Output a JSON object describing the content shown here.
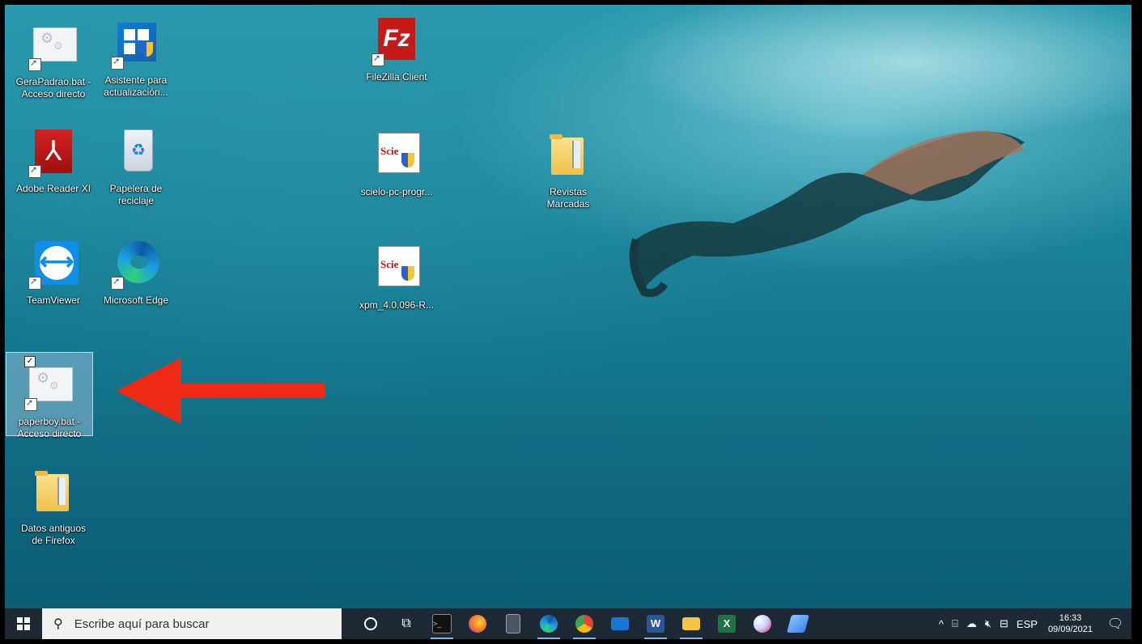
{
  "desktop": {
    "icons": [
      {
        "label": "GeraPadrao.bat -\nAcceso directo",
        "icon": "batch-file-shortcut-icon"
      },
      {
        "label": "Asistente para\nactualización...",
        "icon": "windows-update-assistant-icon"
      },
      {
        "label": "FileZilla Client",
        "icon": "filezilla-icon"
      },
      {
        "label": "Adobe Reader XI",
        "icon": "adobe-reader-icon"
      },
      {
        "label": "Papelera de\nreciclaje",
        "icon": "recycle-bin-icon"
      },
      {
        "label": "scielo-pc-progr...",
        "icon": "scielo-installer-icon"
      },
      {
        "label": "Revistas\nMarcadas",
        "icon": "folder-icon"
      },
      {
        "label": "TeamViewer",
        "icon": "teamviewer-icon"
      },
      {
        "label": "Microsoft Edge",
        "icon": "edge-icon"
      },
      {
        "label": "xpm_4.0.096-R...",
        "icon": "scielo-installer-icon"
      },
      {
        "label": "paperboy.bat -\nAcceso directo",
        "icon": "batch-file-shortcut-icon",
        "selected": true
      },
      {
        "label": "Datos antiguos\nde Firefox",
        "icon": "folder-icon"
      }
    ],
    "annotation_arrow_color": "#ee2a17"
  },
  "taskbar": {
    "search_placeholder": "Escribe aquí para buscar",
    "apps": [
      "cortana-icon",
      "task-view-icon",
      "terminal-icon",
      "firefox-icon",
      "calculator-icon",
      "edge-icon",
      "chrome-icon",
      "mail-icon",
      "word-icon",
      "file-explorer-icon",
      "excel-icon",
      "paint-icon",
      "notes-icon"
    ],
    "tray": {
      "language": "ESP",
      "time": "16:33",
      "date": "09/09/2021"
    },
    "color": "#1d2a35"
  }
}
